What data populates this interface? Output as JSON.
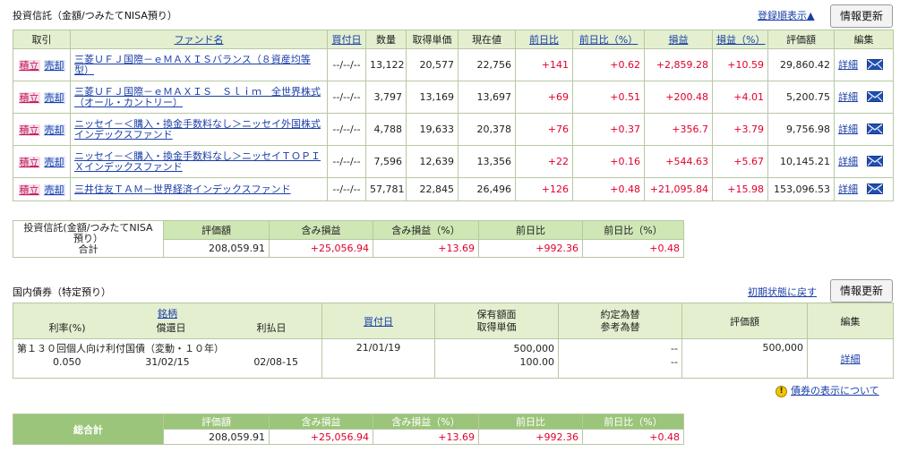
{
  "funds_section": {
    "title": "投資信託（金額/つみたてNISA預り）",
    "sort_link": "登録順表示▲",
    "refresh_label": "情報更新",
    "headers": {
      "trade": "取引",
      "fund_name": "ファンド名",
      "buy_date": "買付日",
      "qty": "数量",
      "unit_cost": "取得単価",
      "current": "現在値",
      "day_change": "前日比",
      "day_change_pct": "前日比（%）",
      "pl": "損益",
      "pl_pct": "損益（%）",
      "value": "評価額",
      "edit": "編集"
    },
    "buy_label": "積立",
    "sell_label": "売却",
    "detail_label": "詳細",
    "rows": [
      {
        "name": "三菱ＵＦＪ国際－ｅＭＡＸＩＳバランス（８資産均等型）",
        "buy_date": "--/--/--",
        "qty": "13,122",
        "unit_cost": "20,577",
        "current": "22,756",
        "day_change": "+141",
        "day_change_pct": "+0.62",
        "pl": "+2,859.28",
        "pl_pct": "+10.59",
        "value": "29,860.42"
      },
      {
        "name": "三菱ＵＦＪ国際－ｅＭＡＸＩＳ　Ｓｌｉｍ　全世界株式（オール・カントリー）",
        "buy_date": "--/--/--",
        "qty": "3,797",
        "unit_cost": "13,169",
        "current": "13,697",
        "day_change": "+69",
        "day_change_pct": "+0.51",
        "pl": "+200.48",
        "pl_pct": "+4.01",
        "value": "5,200.75"
      },
      {
        "name": "ニッセイ－＜購入・換金手数料なし＞ニッセイ外国株式インデックスファンド",
        "buy_date": "--/--/--",
        "qty": "4,788",
        "unit_cost": "19,633",
        "current": "20,378",
        "day_change": "+76",
        "day_change_pct": "+0.37",
        "pl": "+356.7",
        "pl_pct": "+3.79",
        "value": "9,756.98"
      },
      {
        "name": "ニッセイ－＜購入・換金手数料なし＞ニッセイＴＯＰＩＸインデックスファンド",
        "buy_date": "--/--/--",
        "qty": "7,596",
        "unit_cost": "12,639",
        "current": "13,356",
        "day_change": "+22",
        "day_change_pct": "+0.16",
        "pl": "+544.63",
        "pl_pct": "+5.67",
        "value": "10,145.21"
      },
      {
        "name": "三井住友ＴＡＭ－世界経済インデックスファンド",
        "buy_date": "--/--/--",
        "qty": "57,781",
        "unit_cost": "22,845",
        "current": "26,496",
        "day_change": "+126",
        "day_change_pct": "+0.48",
        "pl": "+21,095.84",
        "pl_pct": "+15.98",
        "value": "153,096.53"
      }
    ]
  },
  "funds_total": {
    "label_line1": "投資信託(金額/つみたてNISA",
    "label_line2": "預り）",
    "label_line3": "合計",
    "headers": {
      "value": "評価額",
      "pl": "含み損益",
      "pl_pct": "含み損益（%）",
      "day_change": "前日比",
      "day_change_pct": "前日比（%）"
    },
    "value": "208,059.91",
    "pl": "+25,056.94",
    "pl_pct": "+13.69",
    "day_change": "+992.36",
    "day_change_pct": "+0.48"
  },
  "bonds_section": {
    "title": "国内債券（特定預り）",
    "reset_link": "初期状態に戻す",
    "refresh_label": "情報更新",
    "headers": {
      "brand": "銘柄",
      "rate": "利率(%)",
      "maturity": "償還日",
      "pay_date": "利払日",
      "buy_date": "買付日",
      "face": "保有額面",
      "unit_cost": "取得単価",
      "fx": "約定為替",
      "fx_ref": "参考為替",
      "value": "評価額",
      "edit": "編集"
    },
    "row": {
      "name": "第１３０回個人向け利付国債（変動・１０年）",
      "rate": "0.050",
      "maturity": "31/02/15",
      "pay_date": "02/08-15",
      "buy_date": "21/01/19",
      "face": "500,000",
      "unit_cost": "100.00",
      "fx": "--",
      "fx_ref": "--",
      "value": "500,000",
      "detail": "詳細"
    },
    "notice_link": "債券の表示について"
  },
  "grand_total": {
    "label": "総合計",
    "headers": {
      "value": "評価額",
      "pl": "含み損益",
      "pl_pct": "含み損益（%）",
      "day_change": "前日比",
      "day_change_pct": "前日比（%）"
    },
    "value": "208,059.91",
    "pl": "+25,056.94",
    "pl_pct": "+13.69",
    "day_change": "+992.36",
    "day_change_pct": "+0.48"
  },
  "colors": {
    "header_green": "#e3efcf",
    "border_green": "#b7c8a3",
    "footer_green": "#9bc57a",
    "positive_red": "#e0002a",
    "link_blue": "#1a3fa8"
  },
  "icons": {
    "mail": "mail-icon",
    "info": "info-icon"
  }
}
